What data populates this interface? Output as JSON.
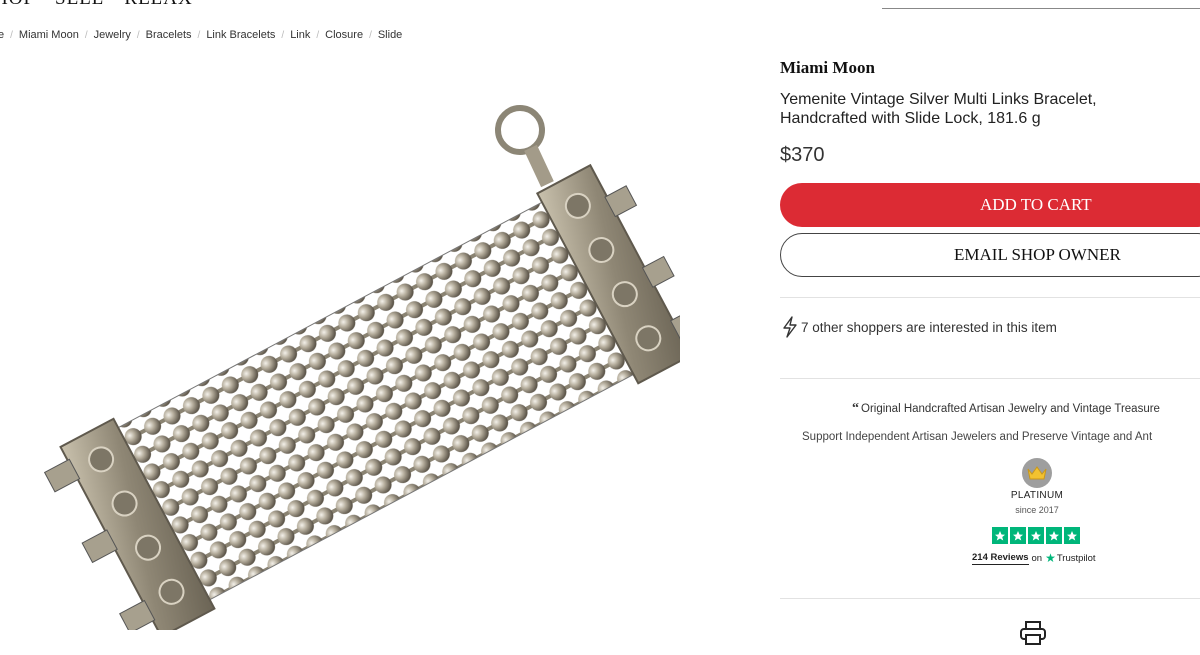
{
  "nav": {
    "items": [
      "HOP",
      "SELL",
      "RELAX"
    ]
  },
  "breadcrumb": [
    "e",
    "Miami Moon",
    "Jewelry",
    "Bracelets",
    "Link Bracelets",
    "Link",
    "Closure",
    "Slide"
  ],
  "product": {
    "shop_name": "Miami Moon",
    "title": "Yemenite Vintage Silver Multi Links Bracelet, Handcrafted with Slide Lock, 181.6 g",
    "price": "$370",
    "add_to_cart": "ADD TO CART",
    "email_owner": "EMAIL SHOP OWNER",
    "interest_text": "7 other shoppers are interested in this item"
  },
  "promo": {
    "quote": "Original Handcrafted Artisan Jewelry and Vintage Treasure",
    "support": "Support Independent Artisan Jewelers and Preserve Vintage and Ant",
    "tier": "PLATINUM",
    "since": "since 2017",
    "reviews_count": "214 Reviews",
    "reviews_on": "on",
    "trustpilot": "Trustpilot",
    "rating_stars": 5
  },
  "colors": {
    "accent": "#dc2b34",
    "trustpilot": "#00b67a",
    "badge": "#9e9e9e"
  },
  "icons": [
    "lightning-icon",
    "crown-icon",
    "star-icon",
    "print-icon"
  ]
}
